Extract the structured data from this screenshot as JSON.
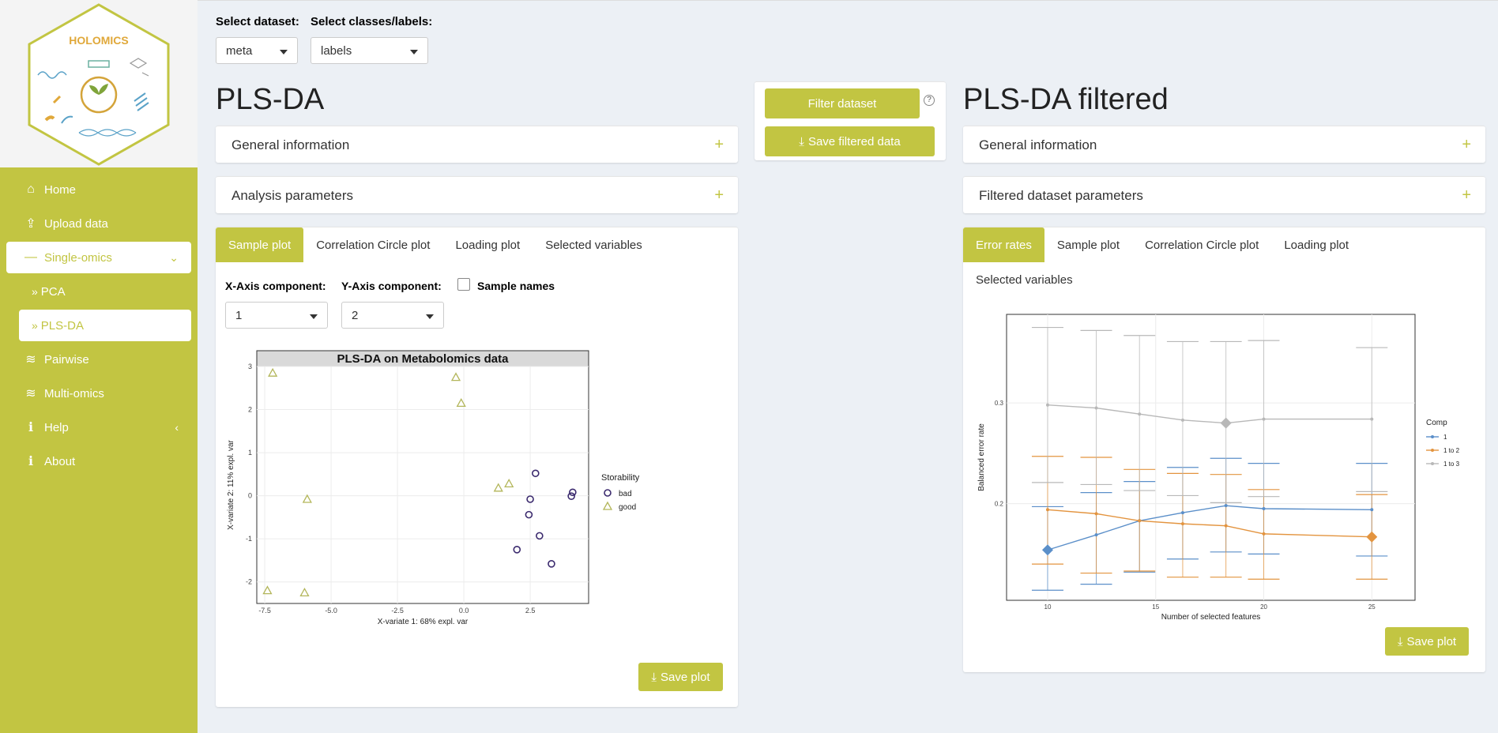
{
  "sidebar": {
    "logo_text": "HOLOMICS",
    "items": [
      {
        "label": "Home",
        "icon": "home-icon"
      },
      {
        "label": "Upload data",
        "icon": "upload-icon"
      },
      {
        "label": "Single-omics",
        "icon": "minus-icon"
      },
      {
        "label": "PCA",
        "icon": "double-chevron-icon"
      },
      {
        "label": "PLS-DA",
        "icon": "double-chevron-icon"
      },
      {
        "label": "Pairwise",
        "icon": "layers-icon"
      },
      {
        "label": "Multi-omics",
        "icon": "layers-icon"
      },
      {
        "label": "Help",
        "icon": "info-icon"
      },
      {
        "label": "About",
        "icon": "info-icon"
      }
    ]
  },
  "top": {
    "dataset_label": "Select dataset:",
    "dataset_value": "meta",
    "classes_label": "Select classes/labels:",
    "classes_value": "labels"
  },
  "left": {
    "title": "PLS-DA",
    "general_info": "General information",
    "analysis_params": "Analysis parameters",
    "tabs": [
      "Sample plot",
      "Correlation Circle plot",
      "Loading plot",
      "Selected variables"
    ],
    "x_axis_label": "X-Axis component:",
    "x_axis_value": "1",
    "y_axis_label": "Y-Axis component:",
    "y_axis_value": "2",
    "sample_names_label": "Sample names",
    "save_plot": "Save plot"
  },
  "middle": {
    "filter_dataset": "Filter dataset",
    "save_filtered": "Save filtered data",
    "help_mark": "?"
  },
  "right": {
    "title": "PLS-DA filtered",
    "general_info": "General information",
    "filtered_params": "Filtered dataset parameters",
    "tabs": [
      "Error rates",
      "Sample plot",
      "Correlation Circle plot",
      "Loading plot"
    ],
    "selected_variables_tab": "Selected variables",
    "save_plot": "Save plot"
  },
  "chart_data": [
    {
      "type": "scatter",
      "title": "PLS-DA on Metabolomics data",
      "xlabel": "X-variate 1: 68% expl. var",
      "ylabel": "X-variate 2: 11% expl. var",
      "xlim": [
        -7.8,
        4.7
      ],
      "ylim": [
        -2.5,
        3.0
      ],
      "x_ticks": [
        -7.5,
        -5.0,
        -2.5,
        0.0,
        2.5
      ],
      "x_tick_labels": [
        "-7.5",
        "-5.0",
        "-2.5",
        "0.0",
        "2.5"
      ],
      "y_ticks": [
        3,
        2,
        1,
        0,
        -1,
        -2
      ],
      "y_tick_labels": [
        "3",
        "2",
        "1",
        "0",
        "-1",
        "-2"
      ],
      "legend_title": "Storability",
      "legend_position": "right",
      "grid": true,
      "series": [
        {
          "name": "bad",
          "marker": "circle",
          "color": "#3b2a6e",
          "points": [
            [
              2.7,
              0.52
            ],
            [
              2.5,
              -0.08
            ],
            [
              2.45,
              -0.44
            ],
            [
              2.85,
              -0.93
            ],
            [
              2.0,
              -1.25
            ],
            [
              3.3,
              -1.58
            ],
            [
              4.1,
              0.08
            ],
            [
              4.05,
              -0.01
            ]
          ]
        },
        {
          "name": "good",
          "marker": "triangle",
          "color": "#b3b65a",
          "points": [
            [
              -7.2,
              2.85
            ],
            [
              -0.3,
              2.75
            ],
            [
              -0.1,
              2.15
            ],
            [
              -5.9,
              -0.08
            ],
            [
              1.3,
              0.18
            ],
            [
              1.7,
              0.28
            ],
            [
              -7.4,
              -2.2
            ],
            [
              -6.0,
              -2.25
            ]
          ]
        }
      ]
    },
    {
      "type": "line",
      "xlabel": "Number of selected features",
      "ylabel": "Balanced error rate",
      "xlim": [
        8.1,
        27.0
      ],
      "ylim": [
        0.104,
        0.388
      ],
      "x_ticks": [
        10,
        15,
        20,
        25
      ],
      "x_tick_labels": [
        "10",
        "15",
        "20",
        "25"
      ],
      "y_ticks": [
        0.2,
        0.3
      ],
      "y_tick_labels": [
        "0.2",
        "0.3"
      ],
      "legend_title": "Comp",
      "legend_position": "right",
      "grid": true,
      "x": [
        10,
        12.25,
        14.25,
        16.25,
        18.25,
        20,
        25
      ],
      "series": [
        {
          "name": "1",
          "color": "#5b8fc9",
          "values": [
            0.154,
            0.169,
            0.183,
            0.191,
            0.198,
            0.195,
            0.194
          ],
          "upper": [
            0.197,
            0.211,
            0.222,
            0.236,
            0.245,
            0.24,
            0.24
          ],
          "lower": [
            0.114,
            0.12,
            0.132,
            0.145,
            0.152,
            0.15,
            0.148
          ],
          "highlight_x": 10
        },
        {
          "name": "1 to 2",
          "color": "#e3943f",
          "values": [
            0.194,
            0.19,
            0.183,
            0.18,
            0.178,
            0.17,
            0.167
          ],
          "upper": [
            0.247,
            0.246,
            0.234,
            0.23,
            0.229,
            0.214,
            0.209
          ],
          "lower": [
            0.14,
            0.131,
            0.133,
            0.127,
            0.127,
            0.125,
            0.125
          ],
          "highlight_x": 25
        },
        {
          "name": "1 to 3",
          "color": "#b8b8b8",
          "values": [
            0.298,
            0.295,
            0.289,
            0.283,
            0.28,
            0.284,
            0.284
          ],
          "upper": [
            0.375,
            0.372,
            0.367,
            0.361,
            0.361,
            0.362,
            0.355
          ],
          "lower": [
            0.221,
            0.219,
            0.213,
            0.208,
            0.201,
            0.207,
            0.212
          ],
          "highlight_x": 18.25
        }
      ]
    }
  ]
}
